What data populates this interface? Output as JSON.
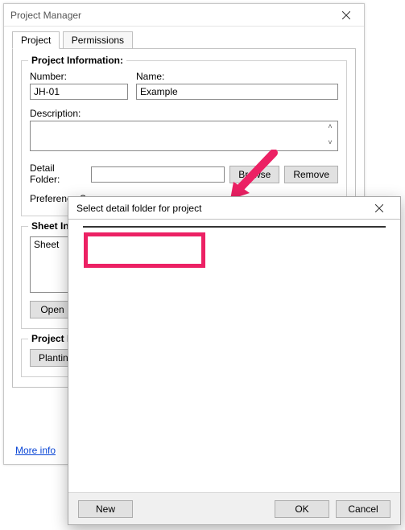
{
  "main": {
    "title": "Project Manager",
    "tabs": {
      "project": "Project",
      "permissions": "Permissions"
    },
    "info": {
      "legend": "Project Information:",
      "number_label": "Number:",
      "number_value": "JH-01",
      "name_label": "Name:",
      "name_value": "Example",
      "description_label": "Description:",
      "detail_label": "Detail Folder:",
      "detail_value": "",
      "browse": "Browse",
      "remove": "Remove",
      "pref_label": "Preference S"
    },
    "sheets": {
      "legend": "Sheet Ind",
      "first_item": "Sheet",
      "open": "Open"
    },
    "data": {
      "legend": "Project Da",
      "planting": "Planting"
    },
    "more": "More info"
  },
  "dialog": {
    "title": "Select detail folder for project",
    "new": "New",
    "ok": "OK",
    "cancel": "Cancel"
  }
}
